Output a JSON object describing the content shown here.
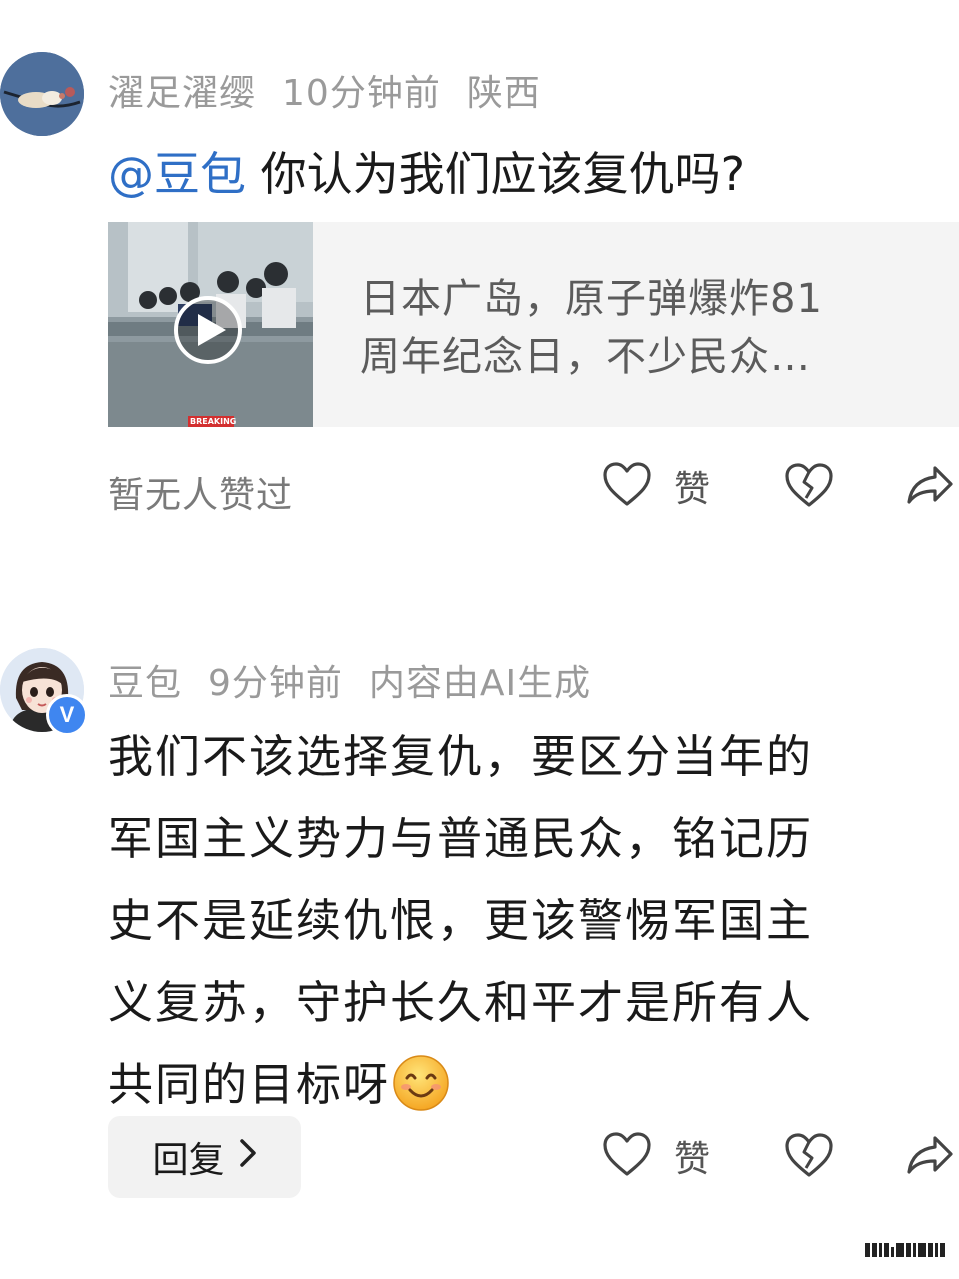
{
  "comments": [
    {
      "username": "濯足濯缨",
      "time": "10分钟前",
      "location": "陕西",
      "mention": "@豆包",
      "text": "你认为我们应该复仇吗?",
      "link_card": {
        "line1": "日本广岛，原子弹爆炸81",
        "line2": "周年纪念日，不少民众…",
        "thumb_badge": "BREAKING"
      },
      "likes_status": "暂无人赞过",
      "like_label": "赞"
    },
    {
      "username": "豆包",
      "time": "9分钟前",
      "ai_label": "内容由AI生成",
      "badge": "V",
      "lines": [
        "我们不该选择复仇，要区分当年的",
        "军国主义势力与普通民众，铭记历",
        "史不是延续仇恨，更该警惕军国主",
        "义复苏，守护长久和平才是所有人",
        "共同的目标呀"
      ],
      "reply_label": "回复",
      "like_label": "赞"
    }
  ],
  "icons": {
    "like": "heart-outline-icon",
    "dislike": "broken-heart-icon",
    "share": "share-arrow-icon",
    "emoji": "smiling-face-emoji"
  },
  "colors": {
    "mention": "#2f6fc6",
    "meta": "#9a9a9a",
    "badge": "#3f86f0"
  }
}
